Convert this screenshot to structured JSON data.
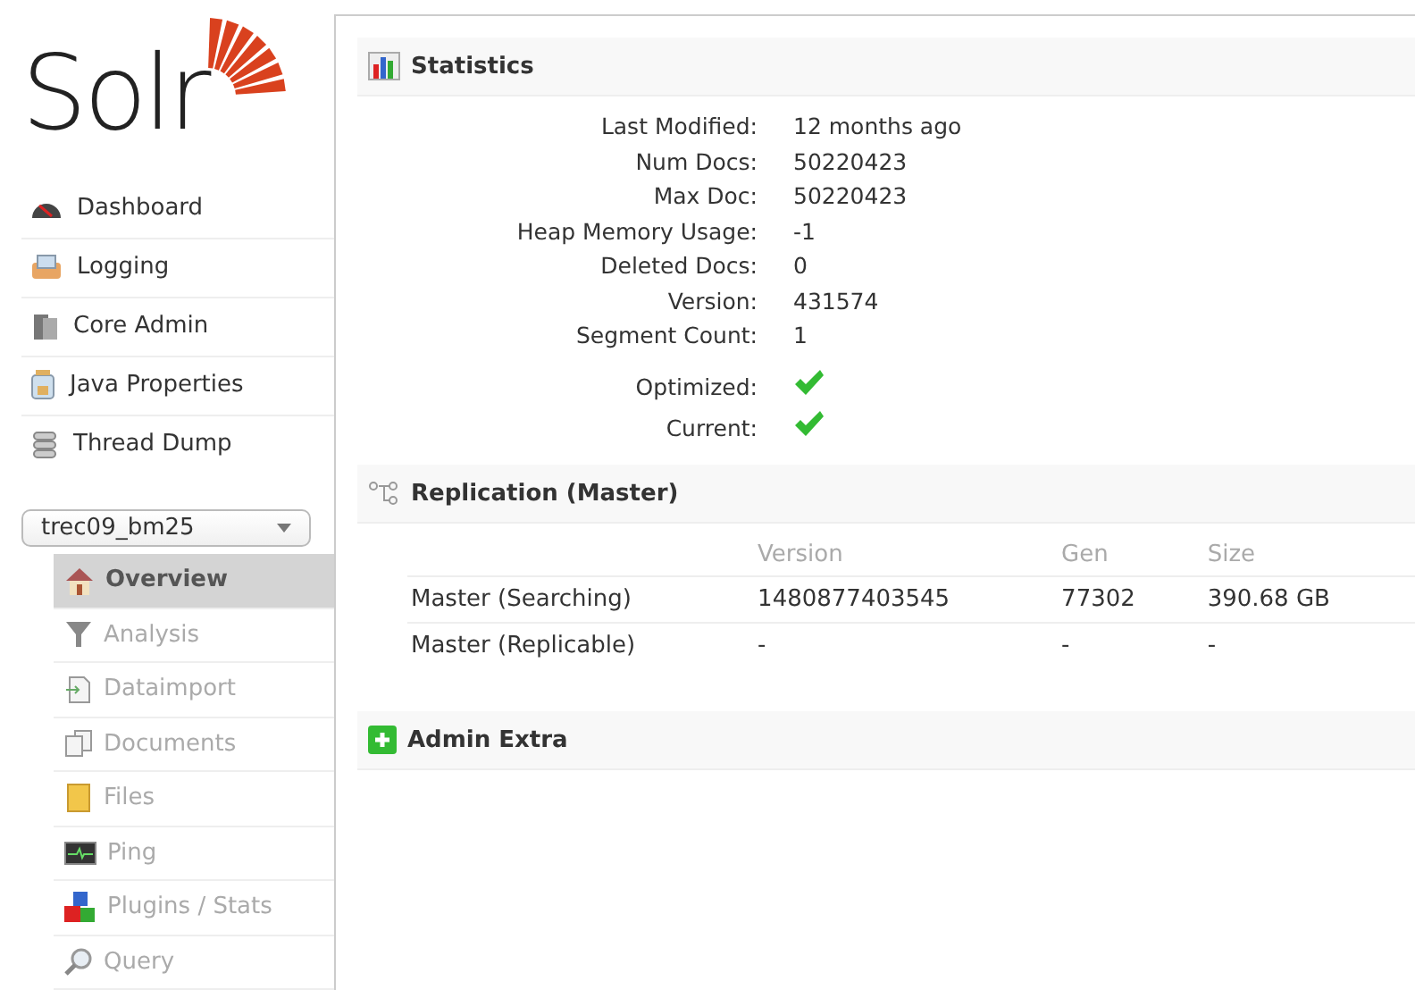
{
  "logo": {
    "text": "Solr"
  },
  "main_menu": [
    {
      "label": "Dashboard"
    },
    {
      "label": "Logging"
    },
    {
      "label": "Core Admin"
    },
    {
      "label": "Java Properties"
    },
    {
      "label": "Thread Dump"
    }
  ],
  "core_selector": {
    "value": "trec09_bm25"
  },
  "core_menu": [
    {
      "label": "Overview",
      "selected": true
    },
    {
      "label": "Analysis",
      "selected": false
    },
    {
      "label": "Dataimport",
      "selected": false
    },
    {
      "label": "Documents",
      "selected": false
    },
    {
      "label": "Files",
      "selected": false
    },
    {
      "label": "Ping",
      "selected": false
    },
    {
      "label": "Plugins / Stats",
      "selected": false
    },
    {
      "label": "Query",
      "selected": false
    }
  ],
  "statistics": {
    "title": "Statistics",
    "rows": [
      {
        "label": "Last Modified:",
        "value": "12 months ago"
      },
      {
        "label": "Num Docs:",
        "value": "50220423"
      },
      {
        "label": "Max Doc:",
        "value": "50220423"
      },
      {
        "label": "Heap Memory Usage:",
        "value": "-1"
      },
      {
        "label": "Deleted Docs:",
        "value": "0"
      },
      {
        "label": "Version:",
        "value": "431574"
      },
      {
        "label": "Segment Count:",
        "value": "1"
      }
    ],
    "flags": [
      {
        "label": "Optimized:",
        "checked": true
      },
      {
        "label": "Current:",
        "checked": true
      }
    ]
  },
  "replication": {
    "title": "Replication (Master)",
    "columns": [
      "Version",
      "Gen",
      "Size"
    ],
    "rows": [
      {
        "label": "Master (Searching)",
        "cells": [
          "1480877403545",
          "77302",
          "390.68 GB"
        ]
      },
      {
        "label": "Master (Replicable)",
        "cells": [
          "-",
          "-",
          "-"
        ]
      }
    ]
  },
  "admin_extra": {
    "title": "Admin Extra",
    "expanded": false
  }
}
